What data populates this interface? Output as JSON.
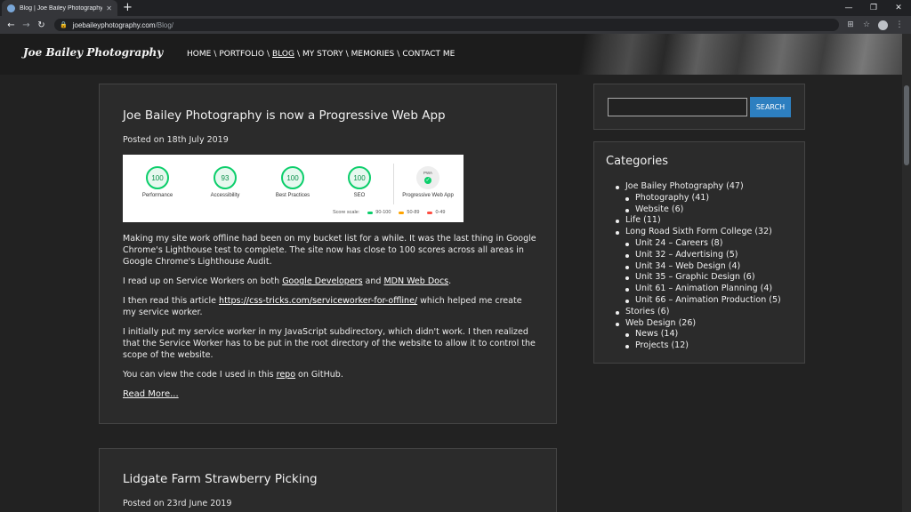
{
  "browser": {
    "tab_title": "Blog | Joe Bailey Photography | S",
    "tab_close": "✕",
    "new_tab": "+",
    "url_host": "joebaileyphotography.com",
    "url_path": "/Blog/",
    "win_min": "—",
    "win_restore": "❐",
    "win_close": "✕"
  },
  "site": {
    "logo": "Joe Bailey Photography",
    "nav": [
      {
        "label": "HOME"
      },
      {
        "label": "PORTFOLIO"
      },
      {
        "label": "BLOG"
      },
      {
        "label": "MY STORY"
      },
      {
        "label": "MEMORIES"
      },
      {
        "label": "CONTACT ME"
      }
    ],
    "nav_sep": "\\"
  },
  "post1": {
    "title": "Joe Bailey Photography is now a Progressive Web App",
    "date": "Posted on 18th July 2019",
    "lighthouse": {
      "scores": [
        {
          "value": "100",
          "label": "Performance"
        },
        {
          "value": "93",
          "label": "Accessibility"
        },
        {
          "value": "100",
          "label": "Best Practices"
        },
        {
          "value": "100",
          "label": "SEO"
        }
      ],
      "pwa_label": "Progressive Web App",
      "pwa_badge": "PWA",
      "scale_label": "Score scale:",
      "scale_ranges": [
        "90-100",
        "50-89",
        "0-49"
      ],
      "colors": {
        "pass": "#0cce6b",
        "average": "#ffa400",
        "fail": "#ff4e42"
      }
    },
    "p1": "Making my site work offline had been on my bucket list for a while. It was the last thing in Google Chrome's Lighthouse test to complete. The site now has close to 100 scores across all areas in Google Chrome's Lighthouse Audit.",
    "p2_a": "I read up on Service Workers on both ",
    "p2_link1": "Google Developers",
    "p2_b": " and ",
    "p2_link2": "MDN Web Docs",
    "p2_c": ".",
    "p3_a": "I then read this article ",
    "p3_link": "https://css-tricks.com/serviceworker-for-offline/",
    "p3_b": " which helped me create my service worker.",
    "p4": "I initially put my service worker in my JavaScript subdirectory, which didn't work. I then realized that the Service Worker has to be put in the root directory of the website to allow it to control the scope of the website.",
    "p5_a": "You can view the code I used in this ",
    "p5_link": "repo",
    "p5_b": " on GitHub.",
    "read_more": "Read More..."
  },
  "post2": {
    "title": "Lidgate Farm Strawberry Picking",
    "date": "Posted on 23rd June 2019"
  },
  "sidebar": {
    "search_button": "SEARCH",
    "categories_title": "Categories",
    "categories": [
      {
        "label": "Joe Bailey Photography",
        "count": " (47)",
        "children": [
          {
            "label": "Photography",
            "count": " (41)"
          },
          {
            "label": "Website",
            "count": " (6)"
          }
        ]
      },
      {
        "label": "Life",
        "count": " (11)",
        "children": []
      },
      {
        "label": "Long Road Sixth Form College",
        "count": " (32)",
        "children": [
          {
            "label": "Unit 24 – Careers",
            "count": " (8)"
          },
          {
            "label": "Unit 32 – Advertising",
            "count": " (5)"
          },
          {
            "label": "Unit 34 – Web Design",
            "count": " (4)"
          },
          {
            "label": "Unit 35 – Graphic Design",
            "count": " (6)"
          },
          {
            "label": "Unit 61 – Animation Planning",
            "count": " (4)"
          },
          {
            "label": "Unit 66 – Animation Production",
            "count": " (5)"
          }
        ]
      },
      {
        "label": "Stories",
        "count": " (6)",
        "children": []
      },
      {
        "label": "Web Design",
        "count": " (26)",
        "children": [
          {
            "label": "News",
            "count": " (14)"
          },
          {
            "label": "Projects",
            "count": " (12)"
          }
        ]
      }
    ]
  }
}
